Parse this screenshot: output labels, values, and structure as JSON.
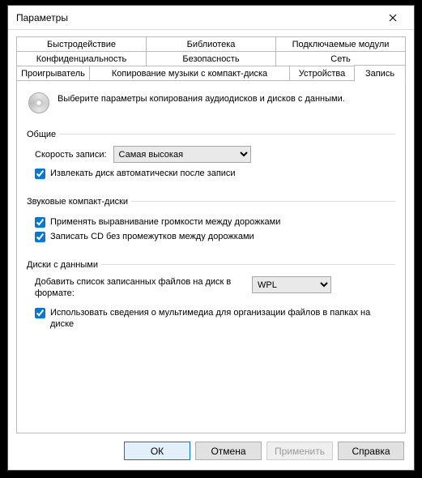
{
  "window": {
    "title": "Параметры"
  },
  "tabs": {
    "row1": [
      "Быстродействие",
      "Библиотека",
      "Подключаемые модули"
    ],
    "row2": [
      "Конфиденциальность",
      "Безопасность",
      "Сеть"
    ],
    "row3": [
      "Проигрыватель",
      "Копирование музыки с компакт-диска",
      "Устройства",
      "Запись"
    ],
    "active": "Запись"
  },
  "description": "Выберите параметры копирования аудиодисков и дисков с данными.",
  "general": {
    "legend": "Общие",
    "speed_label": "Скорость записи:",
    "speed_value": "Самая высокая",
    "eject_label": "Извлекать диск автоматически после записи",
    "eject_checked": true
  },
  "audio": {
    "legend": "Звуковые компакт-диски",
    "leveling_label": "Применять выравнивание громкости между дорожками",
    "leveling_checked": true,
    "nogap_label": "Записать CD без промежутков между дорожками",
    "nogap_checked": true
  },
  "datadisc": {
    "legend": "Диски с данными",
    "addlist_label": "Добавить список записанных файлов на диск в формате:",
    "format_value": "WPL",
    "media_info_label": "Использовать сведения о мультимедиа для организации файлов в папках на диске",
    "media_info_checked": true
  },
  "buttons": {
    "ok": "ОК",
    "cancel": "Отмена",
    "apply": "Применить",
    "help": "Справка"
  }
}
